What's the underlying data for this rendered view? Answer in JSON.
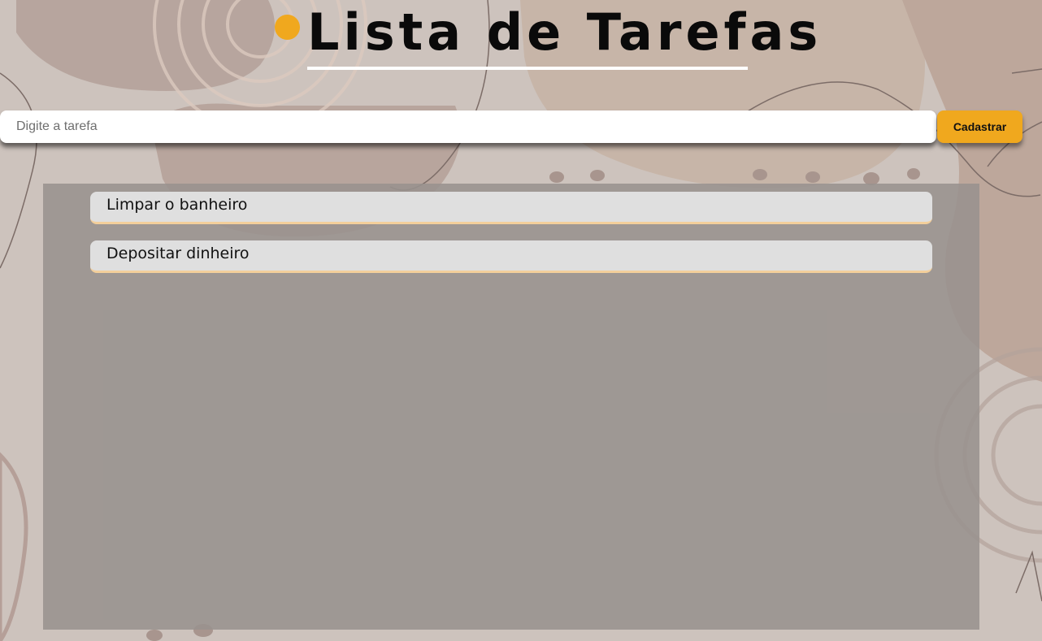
{
  "theme": {
    "accent": "#f0a81e",
    "background": "#cdc3bd",
    "panel": "#9d9793"
  },
  "header": {
    "title": "Lista de Tarefas",
    "bullet_icon": "circle-dot-icon"
  },
  "form": {
    "input_value": "",
    "input_placeholder": "Digite a tarefa",
    "submit_label": "Cadastrar"
  },
  "tasks": [
    {
      "text": "Limpar o banheiro"
    },
    {
      "text": "Depositar dinheiro"
    }
  ]
}
